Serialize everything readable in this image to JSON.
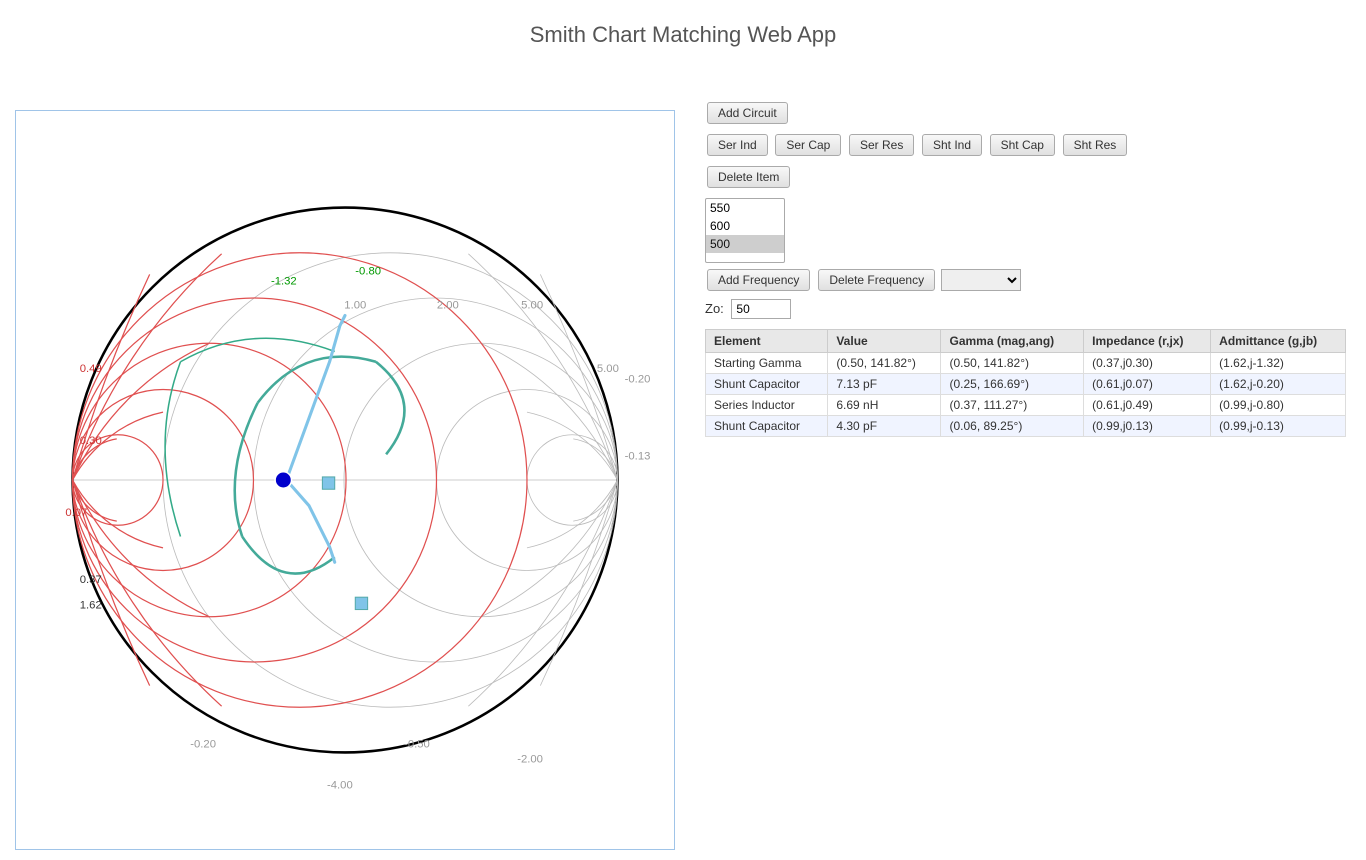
{
  "app": {
    "title": "Smith Chart Matching Web App"
  },
  "controls": {
    "add_circuit_label": "Add Circuit",
    "buttons": [
      {
        "label": "Ser Ind",
        "name": "ser-ind-button"
      },
      {
        "label": "Ser Cap",
        "name": "ser-cap-button"
      },
      {
        "label": "Ser Res",
        "name": "ser-res-button"
      },
      {
        "label": "Sht Ind",
        "name": "sht-ind-button"
      },
      {
        "label": "Sht Cap",
        "name": "sht-cap-button"
      },
      {
        "label": "Sht Res",
        "name": "sht-res-button"
      }
    ],
    "delete_item_label": "Delete Item",
    "add_frequency_label": "Add Frequency",
    "delete_frequency_label": "Delete Frequency",
    "frequencies": [
      {
        "value": "550",
        "selected": false
      },
      {
        "value": "600",
        "selected": false
      },
      {
        "value": "500",
        "selected": true
      }
    ],
    "zo_label": "Zo:",
    "zo_value": "50",
    "table": {
      "headers": [
        "Element",
        "Value",
        "Gamma (mag,ang)",
        "Impedance (r,jx)",
        "Admittance (g,jb)"
      ],
      "rows": [
        {
          "element": "Starting Gamma",
          "value": "(0.50, 141.82°)",
          "gamma": "(0.50, 141.82°)",
          "impedance": "(0.37,j0.30)",
          "admittance": "(1.62,j-1.32)"
        },
        {
          "element": "Shunt Capacitor",
          "value": "7.13 pF",
          "gamma": "(0.25, 166.69°)",
          "impedance": "(0.61,j0.07)",
          "admittance": "(1.62,j-0.20)"
        },
        {
          "element": "Series Inductor",
          "value": "6.69 nH",
          "gamma": "(0.37, 111.27°)",
          "impedance": "(0.61,j0.49)",
          "admittance": "(0.99,j-0.80)"
        },
        {
          "element": "Shunt Capacitor",
          "value": "4.30 pF",
          "gamma": "(0.06, 89.25°)",
          "impedance": "(0.99,j0.13)",
          "admittance": "(0.99,j-0.13)"
        }
      ]
    }
  }
}
